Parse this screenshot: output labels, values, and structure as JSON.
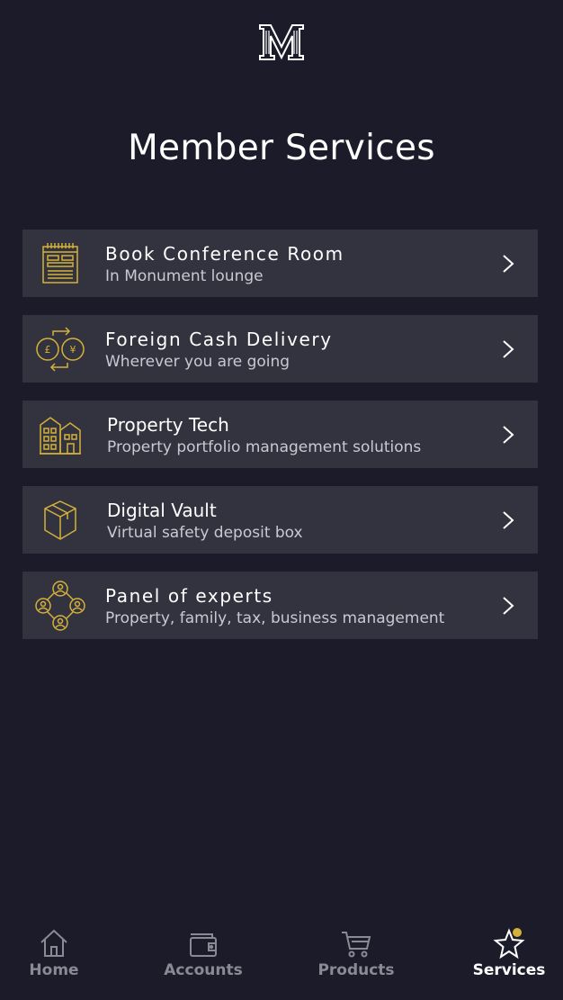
{
  "header": {
    "logo_letter": "M",
    "title": "Member Services"
  },
  "services": [
    {
      "title": "Book Conference Room",
      "subtitle": "In Monument lounge",
      "icon": "notepad-icon"
    },
    {
      "title": "Foreign Cash Delivery",
      "subtitle": "Wherever you are going",
      "icon": "currency-exchange-icon"
    },
    {
      "title": "Property Tech",
      "subtitle": "Property portfolio management solutions",
      "icon": "buildings-icon"
    },
    {
      "title": "Digital Vault",
      "subtitle": "Virtual safety deposit box",
      "icon": "box-icon"
    },
    {
      "title": "Panel of experts",
      "subtitle": "Property, family, tax, business management",
      "icon": "people-network-icon"
    }
  ],
  "tabbar": {
    "items": [
      {
        "label": "Home",
        "icon": "home-icon",
        "active": false
      },
      {
        "label": "Accounts",
        "icon": "wallet-icon",
        "active": false
      },
      {
        "label": "Products",
        "icon": "cart-icon",
        "active": false
      },
      {
        "label": "Services",
        "icon": "star-icon",
        "active": true
      }
    ]
  },
  "colors": {
    "background": "#1b1b2a",
    "card": "#33333f",
    "accent_gold": "#d4b13a",
    "text_secondary": "#c9c9d1",
    "tab_inactive": "#8a8a95"
  }
}
